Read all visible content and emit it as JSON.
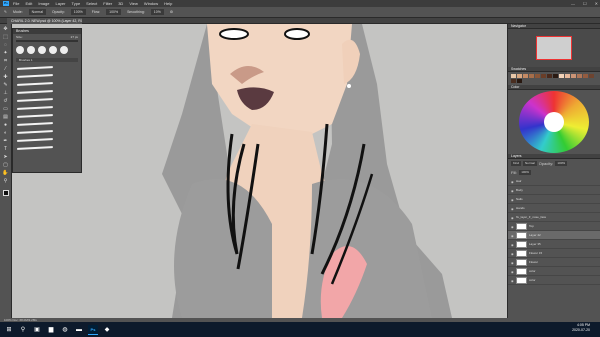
{
  "app": {
    "name": "Ps"
  },
  "menu": [
    "File",
    "Edit",
    "Image",
    "Layer",
    "Type",
    "Select",
    "Filter",
    "3D",
    "View",
    "Window",
    "Help"
  ],
  "window_controls": {
    "minimize": "—",
    "maximize": "☐",
    "close": "✕"
  },
  "options_bar": {
    "mode_label": "Mode:",
    "mode_value": "Normal",
    "opacity_label": "Opacity:",
    "opacity_value": "100%",
    "flow_label": "Flow:",
    "flow_value": "100%",
    "smoothing_label": "Smoothing:",
    "smoothing_value": "10%"
  },
  "document_tab": {
    "title": "CHARIL 2.0. NEW.psd @ 100% (Layer 42, RGB/8)"
  },
  "tools": [
    "move-icon",
    "marquee-icon",
    "lasso-icon",
    "quick-select-icon",
    "crop-icon",
    "eyedropper-icon",
    "healing-icon",
    "brush-icon",
    "stamp-icon",
    "history-brush-icon",
    "eraser-icon",
    "gradient-icon",
    "blur-icon",
    "dodge-icon",
    "pen-icon",
    "type-icon",
    "path-select-icon",
    "shape-icon",
    "hand-icon",
    "zoom-icon"
  ],
  "brushes_panel": {
    "title": "Brushes",
    "size_label": "Size:",
    "size_value": "27 px",
    "folder_label": "Brushes 1"
  },
  "navigator": {
    "title": "Navigator"
  },
  "swatches": {
    "title": "Swatches",
    "colors": [
      "#e8c7a8",
      "#d9a780",
      "#c48a64",
      "#a66e4a",
      "#8a5638",
      "#6a3e28",
      "#4a2a1c",
      "#2a1a12",
      "#f2d2b8",
      "#e8b89a",
      "#cc9476",
      "#b07658",
      "#945c40",
      "#6e4430",
      "#4a2e20",
      "#281810"
    ]
  },
  "color_wheel": {
    "title": "Color"
  },
  "layers": {
    "title": "Layers",
    "kind_label": "Kind",
    "blend_value": "Normal",
    "opacity_label": "Opacity:",
    "opacity_value": "100%",
    "fill_label": "Fill:",
    "fill_value": "100%",
    "items": [
      {
        "name": "Hair"
      },
      {
        "name": "Body"
      },
      {
        "name": "Nails"
      },
      {
        "name": "Hands"
      },
      {
        "name": "fix_layer_fr_nose_face"
      },
      {
        "name": "Top"
      },
      {
        "name": "Layer 42"
      },
      {
        "name": "Layer 35"
      },
      {
        "name": "Flower 15"
      },
      {
        "name": "Flower"
      },
      {
        "name": "color"
      },
      {
        "name": "color"
      }
    ]
  },
  "status_bar": {
    "text": "100%      Doc: 68.0M/3.28G"
  },
  "taskbar": {
    "time": "4:05 PM",
    "date": "2020-07-20"
  }
}
